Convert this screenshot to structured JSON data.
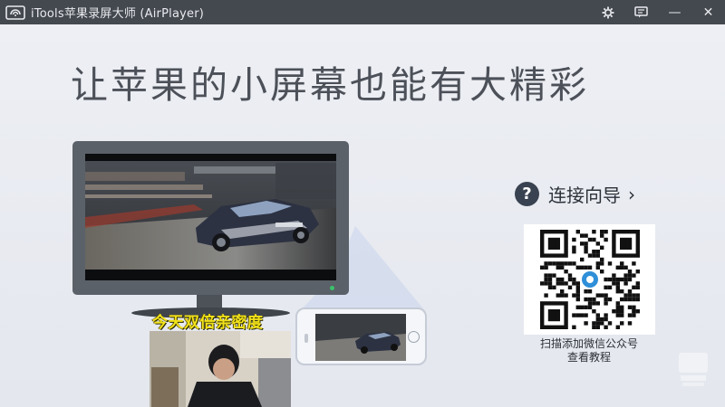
{
  "window": {
    "title": "iTools苹果录屏大师 (AirPlayer)",
    "app_icon": "wifi-cast-icon",
    "controls": {
      "settings_icon": "gear-icon",
      "message_icon": "message-icon",
      "minimize_label": "—",
      "close_label": "✕"
    }
  },
  "main": {
    "slogan": "让苹果的小屏幕也能有大精彩",
    "guide": {
      "icon_glyph": "?",
      "label": "连接向导",
      "chevron": "›"
    },
    "qr": {
      "caption_line1": "扫描添加微信公众号",
      "caption_line2": "查看教程"
    }
  },
  "overlay": {
    "stream_text": "今天双倍亲密度"
  },
  "colors": {
    "titlebar": "#44484f",
    "background": "#e9ecf2",
    "monitor": "#5b6168",
    "accent_text": "#f2e21a"
  }
}
